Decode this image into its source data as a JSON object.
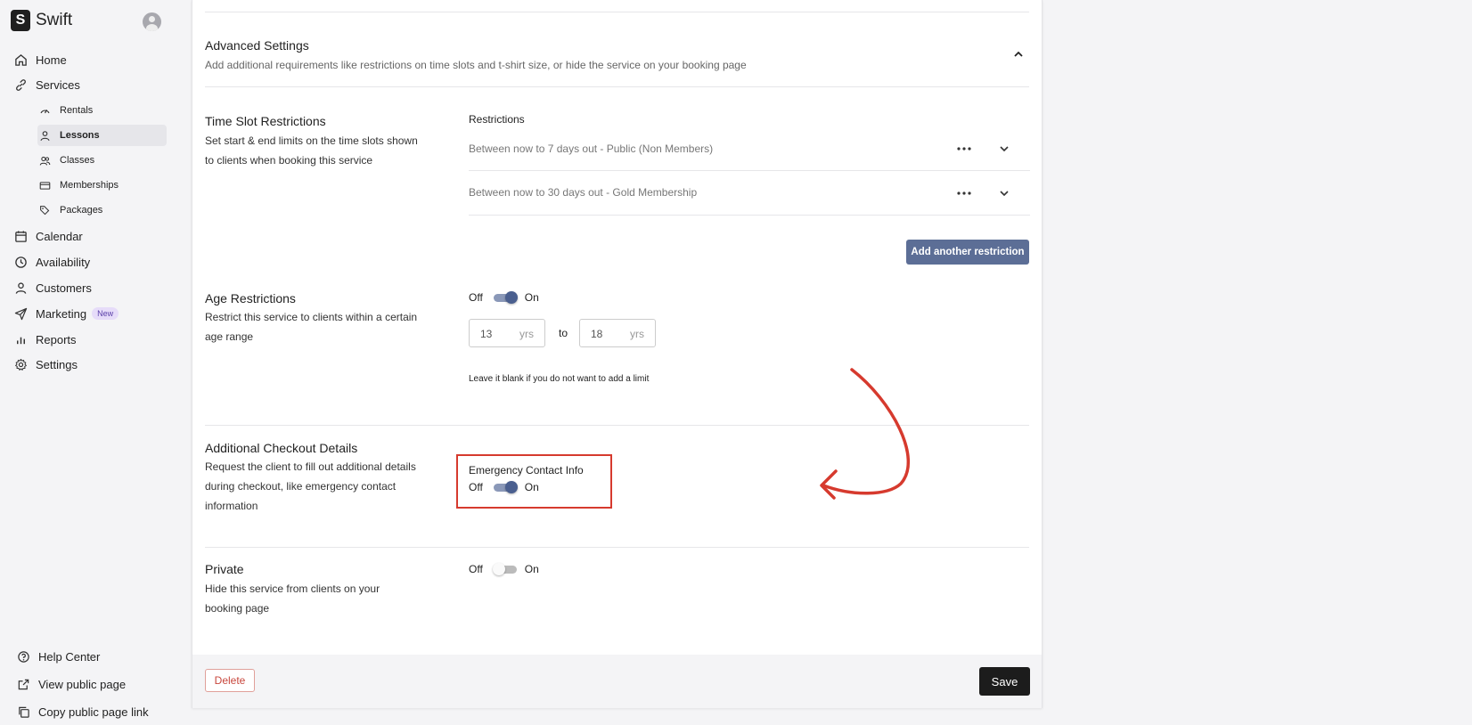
{
  "brand": {
    "logo_letter": "S",
    "name": "Swift"
  },
  "sidebar": {
    "nav": [
      {
        "label": "Home",
        "icon": "home-icon"
      },
      {
        "label": "Services",
        "icon": "link-icon"
      }
    ],
    "sub_items": [
      {
        "label": "Rentals",
        "icon": "gauge-icon"
      },
      {
        "label": "Lessons",
        "icon": "person-icon",
        "active": true
      },
      {
        "label": "Classes",
        "icon": "people-icon"
      },
      {
        "label": "Memberships",
        "icon": "card-icon"
      },
      {
        "label": "Packages",
        "icon": "tags-icon"
      }
    ],
    "nav2": [
      {
        "label": "Calendar",
        "icon": "calendar-icon"
      },
      {
        "label": "Availability",
        "icon": "clock-icon"
      },
      {
        "label": "Customers",
        "icon": "person-icon"
      },
      {
        "label": "Marketing",
        "icon": "send-icon",
        "badge": "New"
      },
      {
        "label": "Reports",
        "icon": "bar-chart-icon"
      },
      {
        "label": "Settings",
        "icon": "gear-icon"
      }
    ],
    "bottom": [
      {
        "label": "Help Center",
        "icon": "help-icon"
      },
      {
        "label": "View public page",
        "icon": "external-link-icon"
      },
      {
        "label": "Copy public page link",
        "icon": "copy-icon"
      }
    ]
  },
  "advanced": {
    "title": "Advanced Settings",
    "subtitle": "Add additional requirements like restrictions on time slots and t-shirt size, or hide the service on your booking page"
  },
  "time_slot": {
    "title": "Time Slot Restrictions",
    "description": "Set start & end limits on the time slots shown to clients when booking this service",
    "restrictions_label": "Restrictions",
    "rows": [
      "Between now to 7 days out - Public (Non Members)",
      "Between now to 30 days out - Gold Membership"
    ],
    "add_button": "Add another restriction"
  },
  "age": {
    "title": "Age Restrictions",
    "description": "Restrict this service to clients within a certain age range",
    "off_label": "Off",
    "on_label": "On",
    "toggle_on": true,
    "min": "13",
    "max": "18",
    "unit": "yrs",
    "to_label": "to",
    "hint": "Leave it blank if you do not want to add a limit"
  },
  "checkout": {
    "title": "Additional Checkout Details",
    "description": "Request the client to fill out additional details during checkout, like emergency contact information",
    "emergency_label": "Emergency Contact Info",
    "off_label": "Off",
    "on_label": "On",
    "toggle_on": true
  },
  "private": {
    "title": "Private",
    "description": "Hide this service from clients on your booking page",
    "off_label": "Off",
    "on_label": "On",
    "toggle_on": false
  },
  "footer": {
    "delete_label": "Delete",
    "save_label": "Save"
  },
  "colors": {
    "annotation": "#d63a2e",
    "accent": "#4a5f8f",
    "button": "#5c6e96"
  }
}
